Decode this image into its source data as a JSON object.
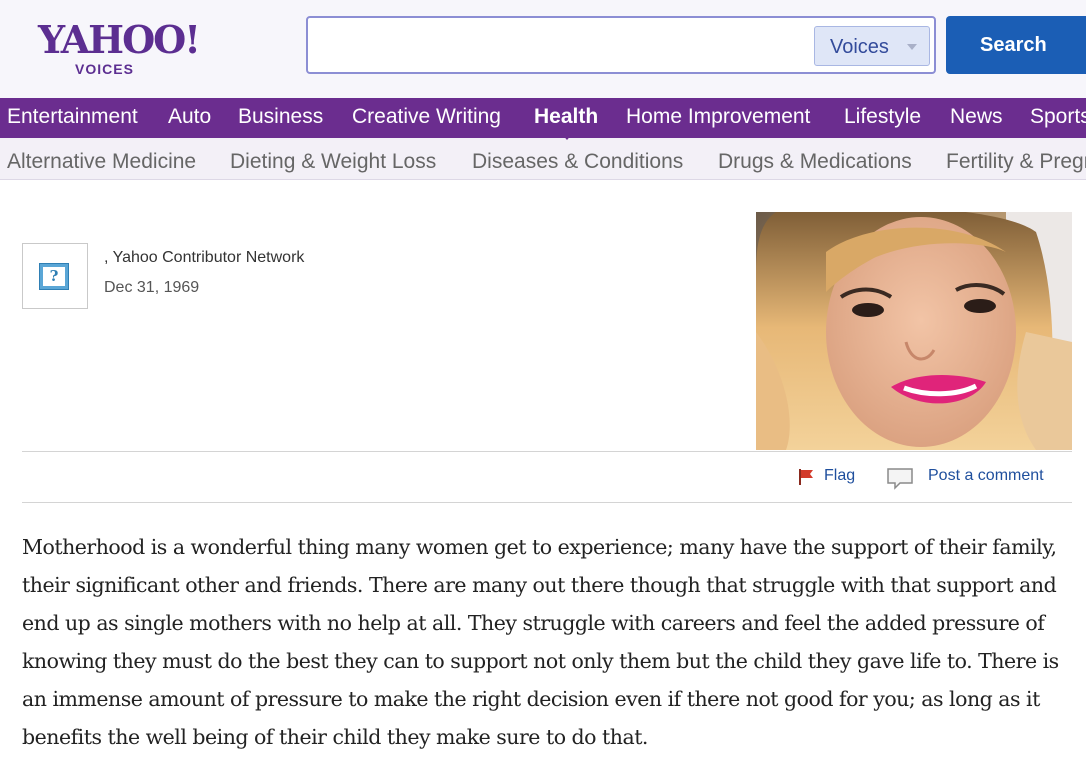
{
  "brand": {
    "logo_text": "YAHOO!",
    "logo_sub": "VOICES",
    "color": "#5c2e91"
  },
  "search": {
    "value": "",
    "placeholder": "",
    "scope_selected": "Voices",
    "button_label": "Search"
  },
  "nav": {
    "primary": [
      {
        "label": "Entertainment",
        "active": false
      },
      {
        "label": "Auto",
        "active": false
      },
      {
        "label": "Business",
        "active": false
      },
      {
        "label": "Creative Writing",
        "active": false
      },
      {
        "label": "Health",
        "active": true
      },
      {
        "label": "Home Improvement",
        "active": false
      },
      {
        "label": "Lifestyle",
        "active": false
      },
      {
        "label": "News",
        "active": false
      },
      {
        "label": "Sports",
        "active": false
      }
    ],
    "secondary": [
      {
        "label": "Alternative Medicine"
      },
      {
        "label": "Dieting & Weight Loss"
      },
      {
        "label": "Diseases & Conditions"
      },
      {
        "label": "Drugs & Medications"
      },
      {
        "label": "Fertility & Pregnancy"
      }
    ],
    "colors": {
      "primary_bg": "#6b2d8f",
      "secondary_bg": "#f3f0f7"
    }
  },
  "byline": {
    "avatar_icon": "question-mark-icon",
    "author": ", Yahoo Contributor Network",
    "date": "Dec 31, 1969"
  },
  "actions": {
    "flag_label": "Flag",
    "flag_icon": "flag-icon",
    "comment_label": "Post a comment",
    "comment_icon": "speech-bubble-icon"
  },
  "article": {
    "body": "Motherhood is a wonderful thing many women get to experience; many have the support of their family, their significant other and friends. There are many out there though that struggle with that support and end up as single mothers with no help at all. They struggle with careers and feel the added pressure of knowing they must do the best they can to support not only them but the child they gave life to. There is an immense amount of pressure to make the right decision even if there not good for you; as long as it benefits the well being of their child they make sure to do that."
  }
}
